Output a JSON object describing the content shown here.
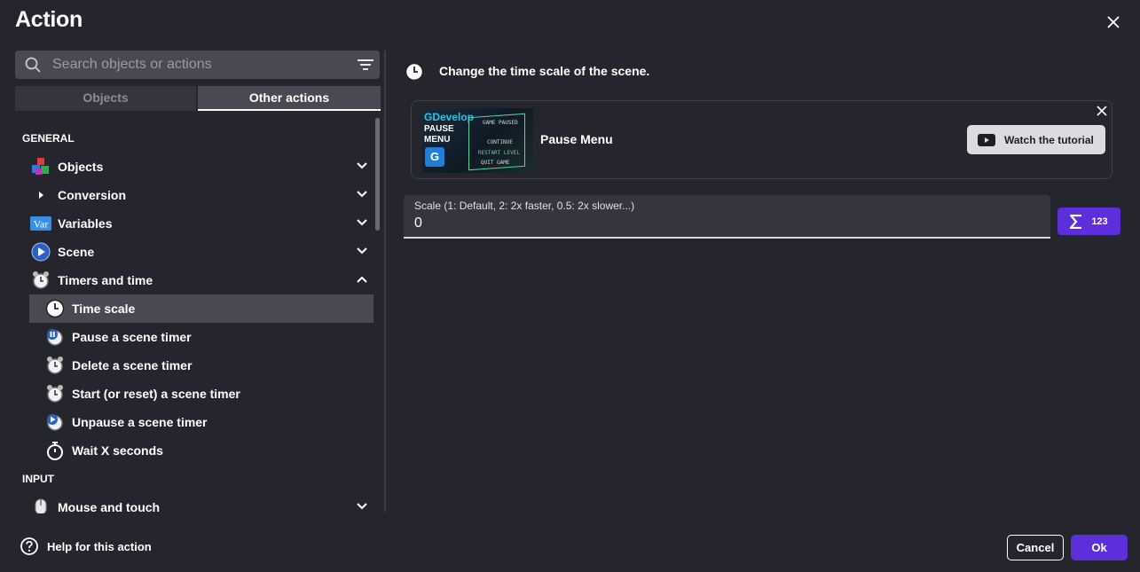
{
  "dialog": {
    "title": "Action"
  },
  "search": {
    "placeholder": "Search objects or actions"
  },
  "tabs": [
    {
      "label": "Objects",
      "active": false
    },
    {
      "label": "Other actions",
      "active": true
    }
  ],
  "sections": {
    "general": "GENERAL",
    "input": "INPUT"
  },
  "groups": [
    {
      "label": "Objects",
      "icon": "objects-cubes-icon",
      "expanded": false
    },
    {
      "label": "Conversion",
      "icon": "arrow-right-icon",
      "expanded": false
    },
    {
      "label": "Variables",
      "icon": "var-icon",
      "expanded": false
    },
    {
      "label": "Scene",
      "icon": "scene-play-icon",
      "expanded": false
    },
    {
      "label": "Timers and time",
      "icon": "alarm-clock-icon",
      "expanded": true
    },
    {
      "label": "Mouse and touch",
      "icon": "mouse-icon",
      "expanded": false
    }
  ],
  "timer_items": [
    {
      "label": "Time scale",
      "icon": "clock-icon",
      "selected": true
    },
    {
      "label": "Pause a scene timer",
      "icon": "pause-timer-icon",
      "selected": false
    },
    {
      "label": "Delete a scene timer",
      "icon": "alarm-clock-icon",
      "selected": false
    },
    {
      "label": "Start (or reset) a scene timer",
      "icon": "alarm-clock-icon",
      "selected": false
    },
    {
      "label": "Unpause a scene timer",
      "icon": "unpause-timer-icon",
      "selected": false
    },
    {
      "label": "Wait X seconds",
      "icon": "stopwatch-icon",
      "selected": false
    }
  ],
  "action": {
    "description": "Change the time scale of the scene.",
    "tutorial": {
      "title": "Pause Menu",
      "watch_label": "Watch the tutorial",
      "thumb": {
        "logo": "GDevelop",
        "heading": "PAUSE\nMENU",
        "badge": "G",
        "game_paused": "GAME PAUSED",
        "continue": "CONTINUE",
        "restart": "RESTART LEVEL",
        "quit": "QUIT GAME"
      }
    },
    "parameter": {
      "label": "Scale (1: Default, 2: 2x faster, 0.5: 2x slower...)",
      "value": "0"
    },
    "expression_button": {
      "label": "123"
    }
  },
  "footer": {
    "help_label": "Help for this action",
    "cancel_label": "Cancel",
    "ok_label": "Ok"
  },
  "colors": {
    "background": "#25252e",
    "accent": "#5c2fdb",
    "selected_row": "#494952"
  }
}
